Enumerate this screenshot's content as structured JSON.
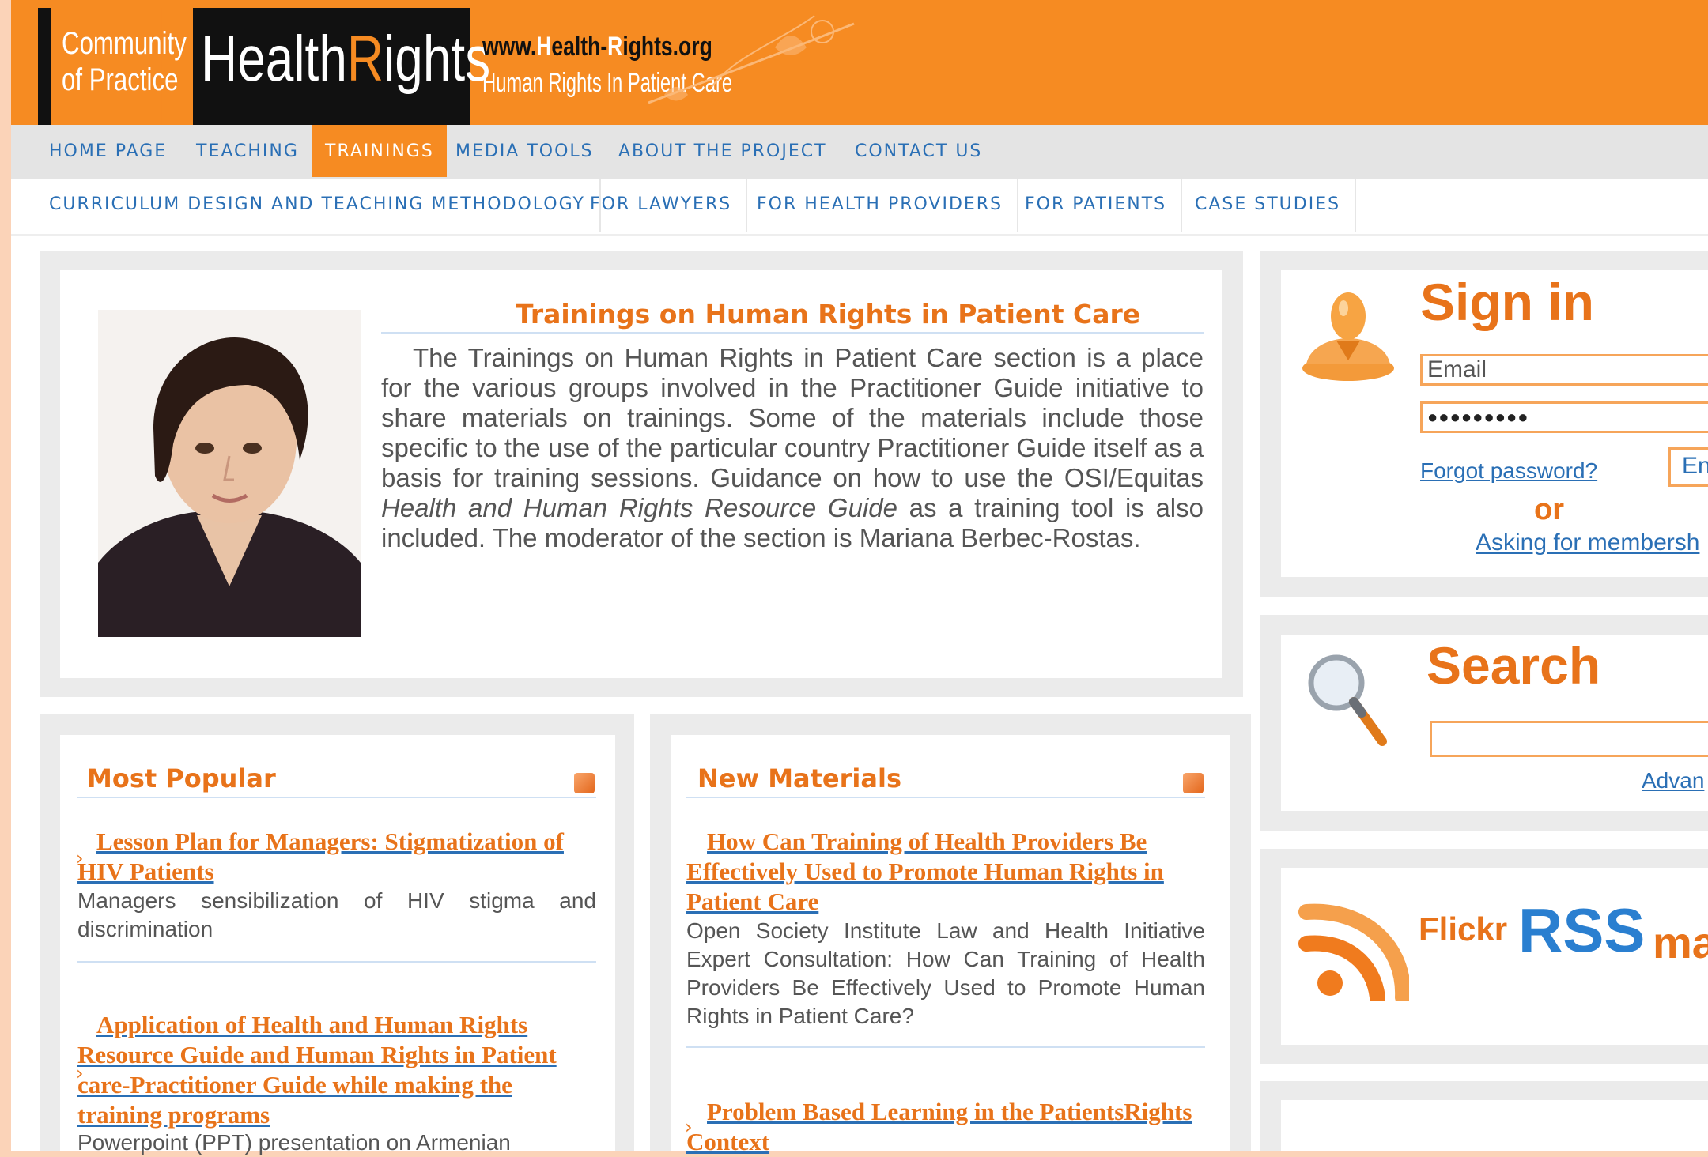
{
  "header": {
    "community_label_1": "Community",
    "community_label_2": "of Practice",
    "logo_part_1": "Health",
    "logo_part_2": "R",
    "logo_part_3": "ights",
    "url_prefix": "www.",
    "url_h": "H",
    "url_mid": "ealth-",
    "url_r": "R",
    "url_end": "ights.org",
    "tagline": "Human Rights In Patient Care"
  },
  "nav_main": [
    {
      "label": "HOME PAGE"
    },
    {
      "label": "TEACHING"
    },
    {
      "label": "TRAININGS"
    },
    {
      "label": "MEDIA TOOLS"
    },
    {
      "label": "ABOUT THE PROJECT"
    },
    {
      "label": "CONTACT US"
    }
  ],
  "nav_sub": [
    {
      "label": "CURRICULUM DESIGN AND TEACHING METHODOLOGY"
    },
    {
      "label": "FOR LAWYERS"
    },
    {
      "label": "FOR HEALTH PROVIDERS"
    },
    {
      "label": "FOR PATIENTS"
    },
    {
      "label": "CASE STUDIES"
    }
  ],
  "intro": {
    "title": "Trainings on Human Rights in Patient Care",
    "text_1": "The Trainings on Human Rights in Patient Care section is a place for the various groups involved in the Practitioner Guide initiative to share materials on trainings. Some of the materials include those specific to the use of the particular country Practitioner Guide itself as a basis for training sessions. Guidance on how to use the OSI/Equitas ",
    "text_em": "Health and Human Rights Resource Guide",
    "text_2": " as a training tool is also included. The moderator of the section is Mariana Berbec-Rostas."
  },
  "most_popular": {
    "title": "Most Popular",
    "items": [
      {
        "title": "Lesson Plan for Managers: Stigmatization of HIV Patients",
        "desc": "Managers sensibilization of HIV stigma and discrimination"
      },
      {
        "title": "Application of Health and Human Rights Resource Guide and Human Rights in Patient care-Practitioner Guide while making the training programs",
        "desc": "Powerpoint (PPT) presentation on Armenian"
      }
    ]
  },
  "new_materials": {
    "title": "New Materials",
    "items": [
      {
        "title": "How Can Training of Health Providers Be Effectively Used to Promote Human Rights in Patient Care",
        "desc": "Open Society Institute Law and Health Initiative Expert Consultation: How Can Training of Health Providers Be Effectively Used to Promote Human Rights in Patient Care?"
      },
      {
        "title": "Problem Based Learning in the PatientsRights Context",
        "desc": ""
      }
    ]
  },
  "sign_in": {
    "title": "Sign in",
    "email_placeholder": "Email",
    "password_mask": "●●●●●●●●●",
    "forgot": "Forgot password?",
    "enter_btn": "En",
    "or": "or",
    "membership": "Asking for membersh"
  },
  "search": {
    "title": "Search",
    "advanced": "Advan"
  },
  "feeds": {
    "flickr": "Flickr",
    "rss": "RSS",
    "more": "ma"
  },
  "colors": {
    "accent": "#f68b22",
    "link": "#2a6fb5",
    "heading": "#e8731a"
  }
}
